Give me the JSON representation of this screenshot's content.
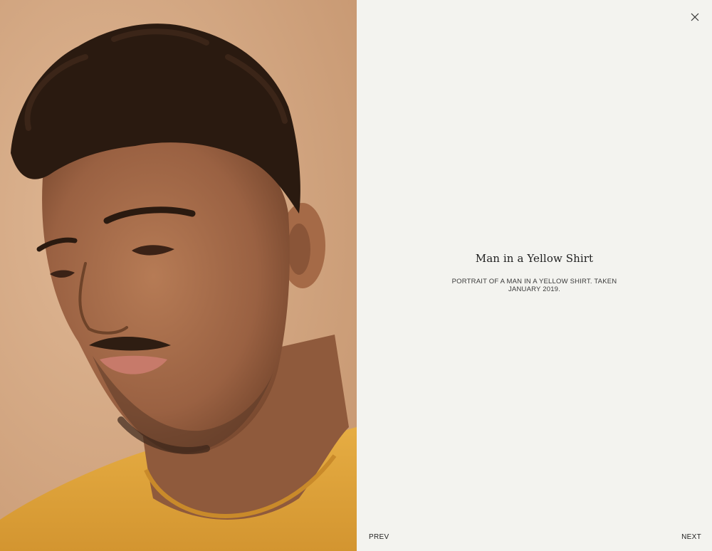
{
  "photo": {
    "subject": "portrait-photo",
    "colors": {
      "background": "#d9b08d",
      "skin": "#a8704c",
      "hair": "#2a1a10",
      "shirt": "#e0a53a"
    }
  },
  "caption": {
    "title": "Man in a Yellow Shirt",
    "description": "PORTRAIT OF A MAN IN A YELLOW SHIRT. TAKEN JANUARY 2019."
  },
  "nav": {
    "prev_label": "PREV",
    "next_label": "NEXT"
  },
  "controls": {
    "close_icon": "close-icon"
  }
}
